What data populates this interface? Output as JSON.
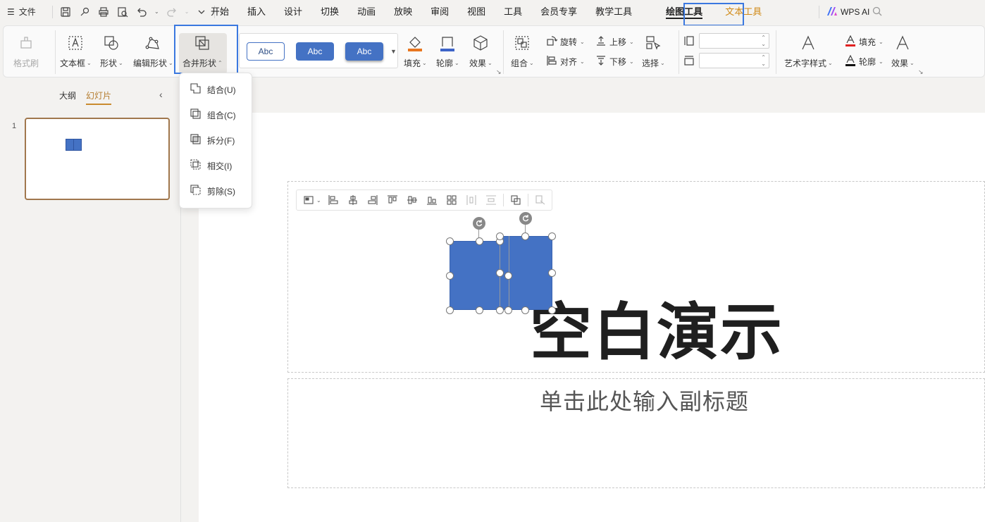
{
  "menu": {
    "file_label": "文件",
    "tabs": [
      "开始",
      "插入",
      "设计",
      "切换",
      "动画",
      "放映",
      "审阅",
      "视图",
      "工具",
      "会员专享",
      "教学工具",
      "绘图工具",
      "文本工具"
    ],
    "active_tab": "绘图工具",
    "ai_label": "WPS AI"
  },
  "ribbon": {
    "format_painter": "格式刷",
    "textbox": "文本框",
    "shape": "形状",
    "edit_shape": "编辑形状",
    "merge_shape": "合并形状",
    "style_samples": [
      "Abc",
      "Abc",
      "Abc"
    ],
    "fill": "填充",
    "outline": "轮廓",
    "effect": "效果",
    "group": "组合",
    "rotate": "旋转",
    "align": "对齐",
    "bring_forward": "上移",
    "send_backward": "下移",
    "select": "选择",
    "height_value": "",
    "width_value": "",
    "art_text_style": "艺术字样式",
    "text_fill": "填充",
    "text_outline": "轮廓",
    "text_effect": "效果"
  },
  "merge_menu": {
    "items": [
      "结合(U)",
      "组合(C)",
      "拆分(F)",
      "相交(I)",
      "剪除(S)"
    ]
  },
  "left_panel": {
    "tab_outline": "大纲",
    "tab_slides": "幻灯片",
    "slide_number": "1"
  },
  "slide": {
    "title": "空白演示",
    "subtitle": "单击此处输入副标题"
  },
  "colors": {
    "accent": "#3a78e0",
    "shape_fill": "#4472c4",
    "text_tool_tab": "#d08a17",
    "active_slide_border": "#a0774d"
  },
  "icons": {
    "float_toolbar": [
      "shape-style-icon",
      "align-left-icon",
      "align-center-icon",
      "align-right-icon",
      "align-top-icon",
      "align-middle-icon",
      "align-bottom-icon",
      "distribute-icon",
      "distribute-horizontal-icon",
      "distribute-vertical-icon",
      "merge-shape-icon",
      "format-icon"
    ]
  }
}
